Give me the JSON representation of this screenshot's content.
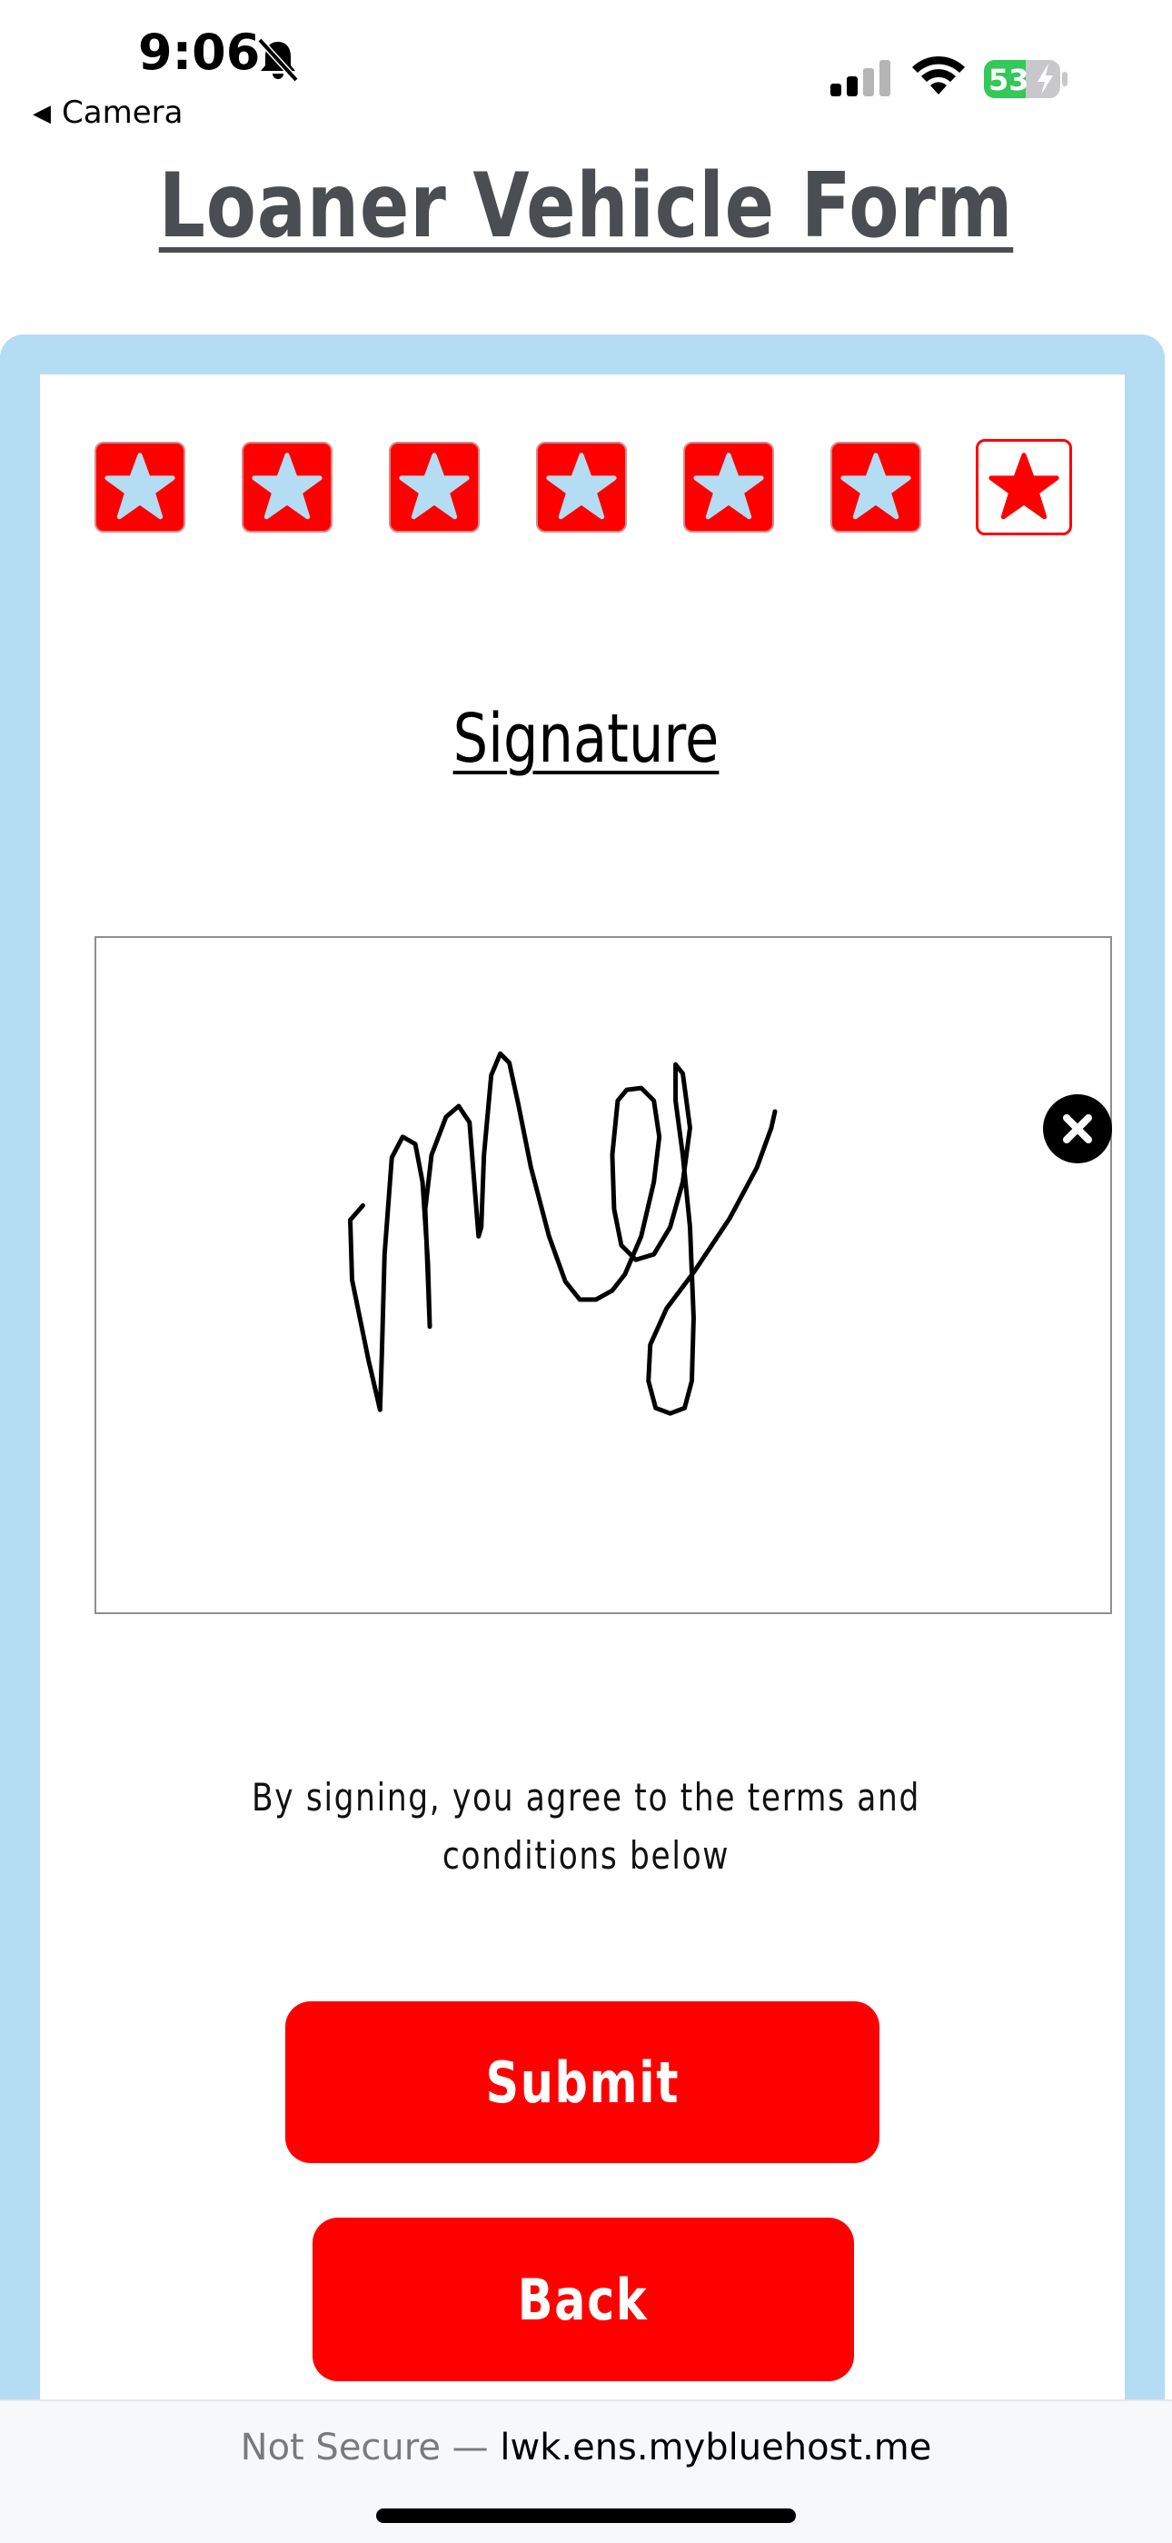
{
  "status_bar": {
    "time": "9:06",
    "back_app": "Camera",
    "battery_percent": "53",
    "battery_color": "#34c759",
    "icons": [
      "bell-slash-icon",
      "signal-icon",
      "wifi-icon",
      "battery-charging-icon"
    ]
  },
  "page": {
    "title": "Loaner Vehicle Form"
  },
  "progress": {
    "total_steps": 7,
    "current_step": 7,
    "step_icon": "star-icon",
    "completed_color": "#ff0000",
    "star_completed_color": "#b4dcf2"
  },
  "signature": {
    "title": "Signature",
    "clear_icon": "close-icon"
  },
  "terms": {
    "line1": "By signing, you agree to the terms and",
    "line2": "conditions below"
  },
  "buttons": {
    "submit_label": "Submit",
    "back_label": "Back",
    "color": "#ff0000"
  },
  "browser": {
    "security_label": "Not Secure —",
    "domain": "lwk.ens.mybluehost.me"
  },
  "colors": {
    "title": "#4a4d52",
    "frame": "#b4dcf2"
  }
}
